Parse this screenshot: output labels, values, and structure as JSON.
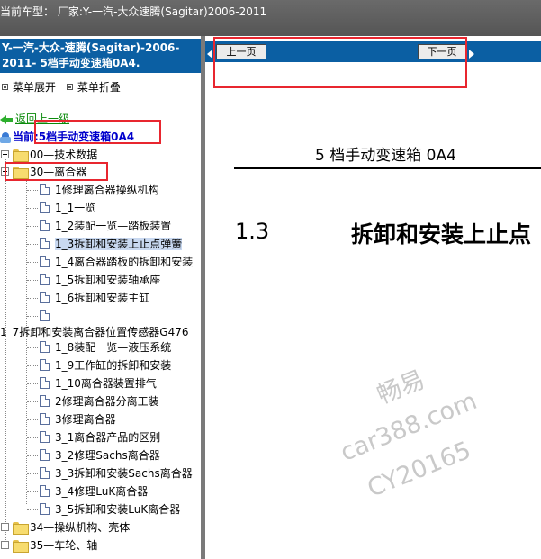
{
  "titlebar": {
    "text": "当前车型：  厂家:Y-一汽-大众速腾(Sagitar)2006-2011"
  },
  "left": {
    "header_line1": "Y-一汽-大众-速腾(Sagitar)-2006-",
    "header_line2": "2011- 5档手动变速箱0A4.",
    "menu_expand": "菜单展开",
    "menu_collapse": "菜单折叠",
    "back_label": "返回上一级",
    "current_label": "当前:5档手动变速箱0A4",
    "tree": {
      "folder_00": "00—技术数据",
      "folder_30": "30—离合器",
      "items": [
        "1修理离合器操纵机构",
        "1_1一览",
        "1_2装配一览—踏板装置",
        "1_3拆卸和安装上止点弹簧",
        "1_4离合器踏板的拆卸和安装",
        "1_5拆卸和安装轴承座",
        "1_6拆卸和安装主缸",
        ""
      ],
      "long_item": "1_7拆卸和安装离合器位置传感器G476",
      "items2": [
        "1_8装配一览—液压系统",
        "1_9工作缸的拆卸和安装",
        "1_10离合器装置排气",
        "2修理离合器分离工装",
        "3修理离合器",
        "3_1离合器产品的区别",
        "3_2修理Sachs离合器",
        "3_3拆卸和安装Sachs离合器",
        "3_4修理LuK离合器",
        "3_5拆卸和安装LuK离合器"
      ],
      "folder_34": "34—操纵机构、壳体",
      "folder_35": "35—车轮、轴"
    }
  },
  "right": {
    "prev_label": "上一页",
    "next_label": "下一页",
    "doc_title": "5 档手动变速箱 0A4",
    "section_num": "1.3",
    "section_title": "拆卸和安装上止点"
  },
  "watermark": {
    "line1": "畅易",
    "line2": "car388.com",
    "line3": "CY20165"
  },
  "colors": {
    "header_blue": "#0b5fa3",
    "highlight_red": "#e8262f",
    "current_blue": "#0000cc",
    "back_green": "#0a8a0a"
  }
}
